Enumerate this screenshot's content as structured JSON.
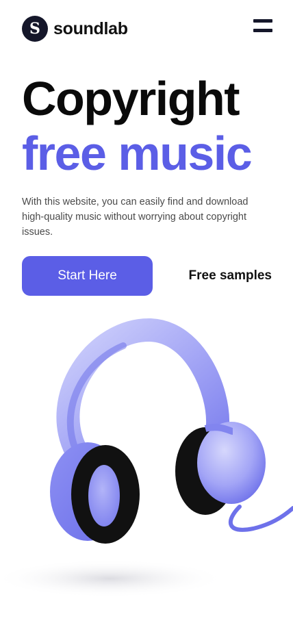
{
  "header": {
    "logo_letter": "S",
    "brand": "soundlab",
    "menu_icon": "hamburger-menu-icon"
  },
  "hero": {
    "headline_line1": "Copyright",
    "headline_line2": "free music",
    "description": "With this website, you can easily find and download high-quality music without worrying about copyright issues.",
    "primary_cta": "Start Here",
    "secondary_cta": "Free samples"
  },
  "colors": {
    "accent": "#5b5ee6",
    "dark": "#15172a",
    "text_muted": "#4a4a4a"
  },
  "illustration": {
    "icon": "headphones-illustration"
  }
}
